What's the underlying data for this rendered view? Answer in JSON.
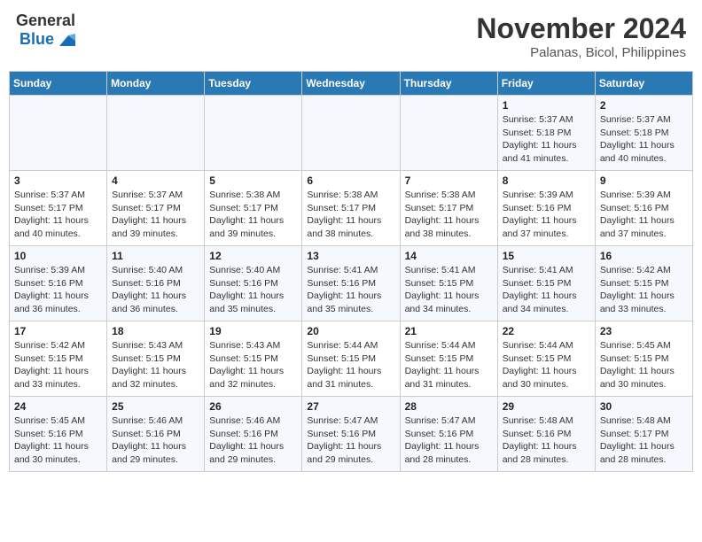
{
  "header": {
    "logo_general": "General",
    "logo_blue": "Blue",
    "title": "November 2024",
    "subtitle": "Palanas, Bicol, Philippines"
  },
  "weekdays": [
    "Sunday",
    "Monday",
    "Tuesday",
    "Wednesday",
    "Thursday",
    "Friday",
    "Saturday"
  ],
  "weeks": [
    [
      {
        "day": "",
        "info": ""
      },
      {
        "day": "",
        "info": ""
      },
      {
        "day": "",
        "info": ""
      },
      {
        "day": "",
        "info": ""
      },
      {
        "day": "",
        "info": ""
      },
      {
        "day": "1",
        "info": "Sunrise: 5:37 AM\nSunset: 5:18 PM\nDaylight: 11 hours\nand 41 minutes."
      },
      {
        "day": "2",
        "info": "Sunrise: 5:37 AM\nSunset: 5:18 PM\nDaylight: 11 hours\nand 40 minutes."
      }
    ],
    [
      {
        "day": "3",
        "info": "Sunrise: 5:37 AM\nSunset: 5:17 PM\nDaylight: 11 hours\nand 40 minutes."
      },
      {
        "day": "4",
        "info": "Sunrise: 5:37 AM\nSunset: 5:17 PM\nDaylight: 11 hours\nand 39 minutes."
      },
      {
        "day": "5",
        "info": "Sunrise: 5:38 AM\nSunset: 5:17 PM\nDaylight: 11 hours\nand 39 minutes."
      },
      {
        "day": "6",
        "info": "Sunrise: 5:38 AM\nSunset: 5:17 PM\nDaylight: 11 hours\nand 38 minutes."
      },
      {
        "day": "7",
        "info": "Sunrise: 5:38 AM\nSunset: 5:17 PM\nDaylight: 11 hours\nand 38 minutes."
      },
      {
        "day": "8",
        "info": "Sunrise: 5:39 AM\nSunset: 5:16 PM\nDaylight: 11 hours\nand 37 minutes."
      },
      {
        "day": "9",
        "info": "Sunrise: 5:39 AM\nSunset: 5:16 PM\nDaylight: 11 hours\nand 37 minutes."
      }
    ],
    [
      {
        "day": "10",
        "info": "Sunrise: 5:39 AM\nSunset: 5:16 PM\nDaylight: 11 hours\nand 36 minutes."
      },
      {
        "day": "11",
        "info": "Sunrise: 5:40 AM\nSunset: 5:16 PM\nDaylight: 11 hours\nand 36 minutes."
      },
      {
        "day": "12",
        "info": "Sunrise: 5:40 AM\nSunset: 5:16 PM\nDaylight: 11 hours\nand 35 minutes."
      },
      {
        "day": "13",
        "info": "Sunrise: 5:41 AM\nSunset: 5:16 PM\nDaylight: 11 hours\nand 35 minutes."
      },
      {
        "day": "14",
        "info": "Sunrise: 5:41 AM\nSunset: 5:15 PM\nDaylight: 11 hours\nand 34 minutes."
      },
      {
        "day": "15",
        "info": "Sunrise: 5:41 AM\nSunset: 5:15 PM\nDaylight: 11 hours\nand 34 minutes."
      },
      {
        "day": "16",
        "info": "Sunrise: 5:42 AM\nSunset: 5:15 PM\nDaylight: 11 hours\nand 33 minutes."
      }
    ],
    [
      {
        "day": "17",
        "info": "Sunrise: 5:42 AM\nSunset: 5:15 PM\nDaylight: 11 hours\nand 33 minutes."
      },
      {
        "day": "18",
        "info": "Sunrise: 5:43 AM\nSunset: 5:15 PM\nDaylight: 11 hours\nand 32 minutes."
      },
      {
        "day": "19",
        "info": "Sunrise: 5:43 AM\nSunset: 5:15 PM\nDaylight: 11 hours\nand 32 minutes."
      },
      {
        "day": "20",
        "info": "Sunrise: 5:44 AM\nSunset: 5:15 PM\nDaylight: 11 hours\nand 31 minutes."
      },
      {
        "day": "21",
        "info": "Sunrise: 5:44 AM\nSunset: 5:15 PM\nDaylight: 11 hours\nand 31 minutes."
      },
      {
        "day": "22",
        "info": "Sunrise: 5:44 AM\nSunset: 5:15 PM\nDaylight: 11 hours\nand 30 minutes."
      },
      {
        "day": "23",
        "info": "Sunrise: 5:45 AM\nSunset: 5:15 PM\nDaylight: 11 hours\nand 30 minutes."
      }
    ],
    [
      {
        "day": "24",
        "info": "Sunrise: 5:45 AM\nSunset: 5:16 PM\nDaylight: 11 hours\nand 30 minutes."
      },
      {
        "day": "25",
        "info": "Sunrise: 5:46 AM\nSunset: 5:16 PM\nDaylight: 11 hours\nand 29 minutes."
      },
      {
        "day": "26",
        "info": "Sunrise: 5:46 AM\nSunset: 5:16 PM\nDaylight: 11 hours\nand 29 minutes."
      },
      {
        "day": "27",
        "info": "Sunrise: 5:47 AM\nSunset: 5:16 PM\nDaylight: 11 hours\nand 29 minutes."
      },
      {
        "day": "28",
        "info": "Sunrise: 5:47 AM\nSunset: 5:16 PM\nDaylight: 11 hours\nand 28 minutes."
      },
      {
        "day": "29",
        "info": "Sunrise: 5:48 AM\nSunset: 5:16 PM\nDaylight: 11 hours\nand 28 minutes."
      },
      {
        "day": "30",
        "info": "Sunrise: 5:48 AM\nSunset: 5:17 PM\nDaylight: 11 hours\nand 28 minutes."
      }
    ]
  ]
}
